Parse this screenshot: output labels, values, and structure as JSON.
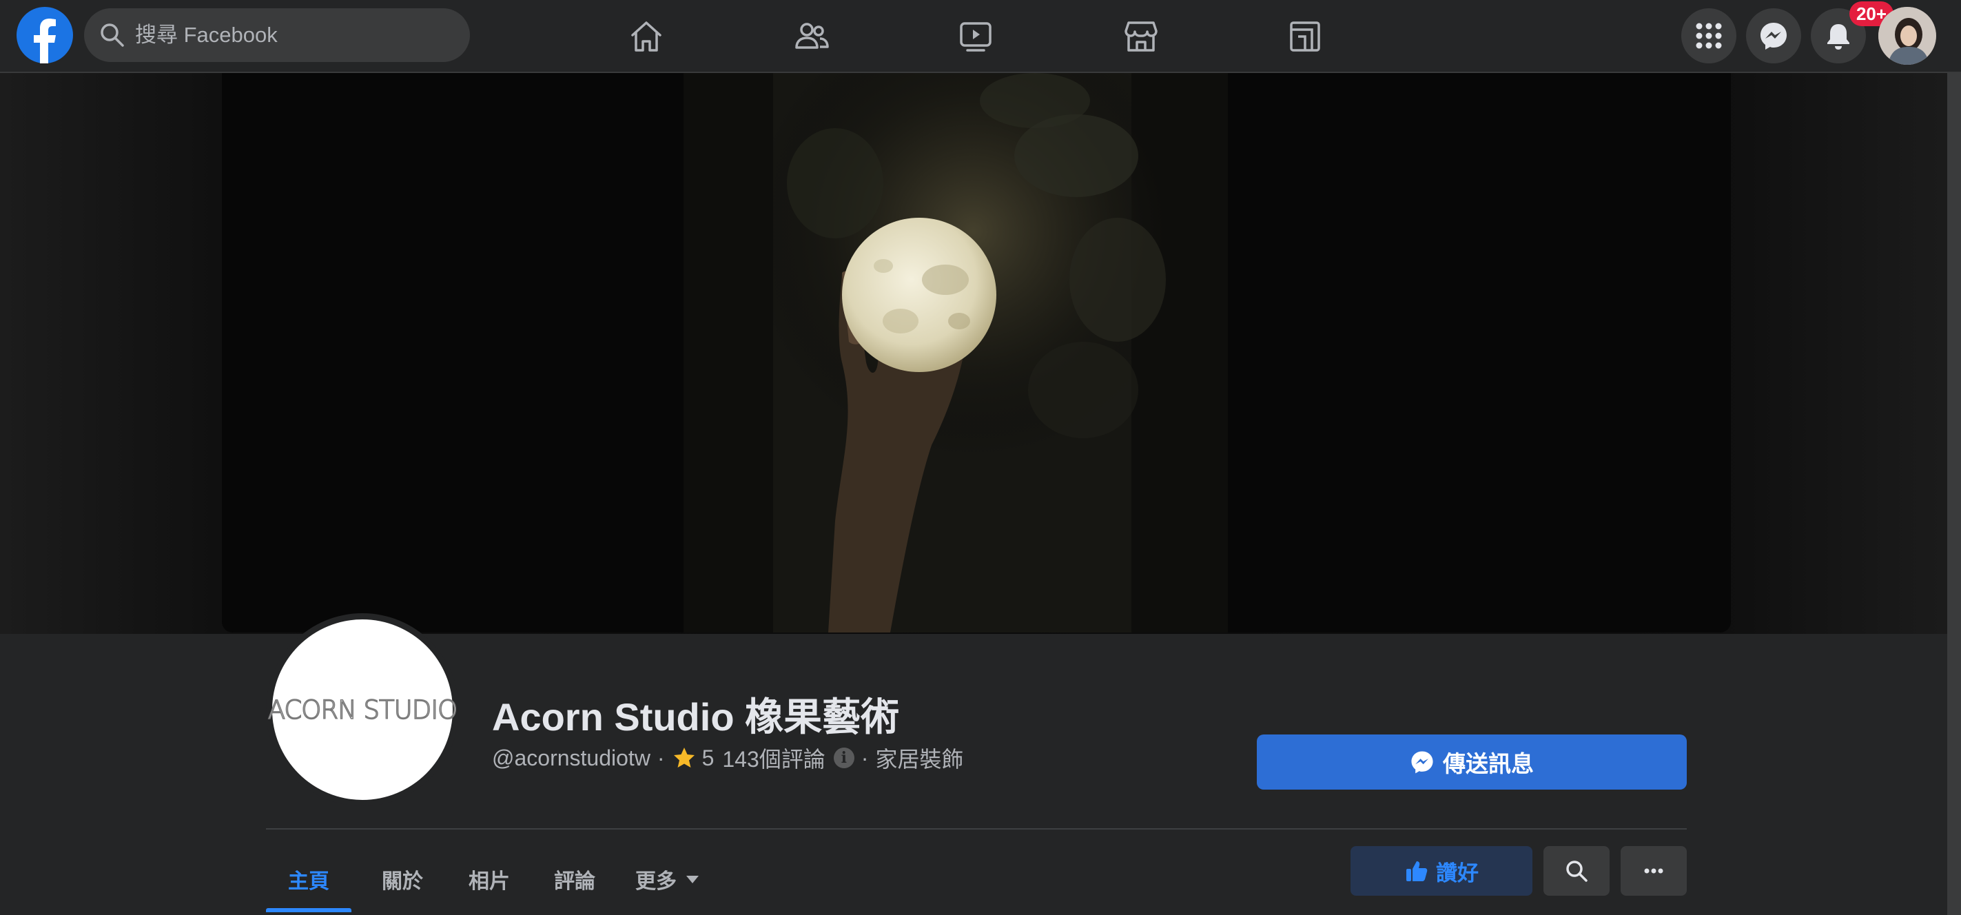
{
  "topbar": {
    "search_placeholder": "搜尋 Facebook",
    "notification_count": "20+"
  },
  "icons": {
    "logo": "facebook-logo",
    "search": "search-icon",
    "nav": [
      "home-icon",
      "friends-icon",
      "watch-icon",
      "marketplace-icon",
      "gaming-icon"
    ],
    "right": [
      "menu-grid-icon",
      "messenger-icon",
      "bell-icon",
      "avatar"
    ]
  },
  "page": {
    "logo_text": "ACORN STUDIO",
    "name": "Acorn Studio 橡果藝術",
    "handle": "@acornstudiotw",
    "separator": "·",
    "rating": "5",
    "reviews": "143個評論",
    "category": "家居裝飾",
    "send_message_label": "傳送訊息"
  },
  "tabs": [
    {
      "label": "主頁",
      "active": true
    },
    {
      "label": "關於",
      "active": false
    },
    {
      "label": "相片",
      "active": false
    },
    {
      "label": "評論",
      "active": false
    },
    {
      "label": "更多",
      "active": false
    }
  ],
  "actions": {
    "like_label": "讚好"
  },
  "colors": {
    "primary": "#2d6ed5",
    "link_blue": "#2d88ff",
    "badge_red": "#e41e3f",
    "background": "#242526",
    "surface": "#3a3b3c"
  }
}
